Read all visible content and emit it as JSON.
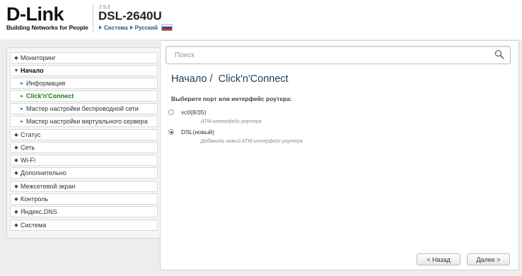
{
  "header": {
    "logo_text": "D-Link",
    "logo_tagline": "Building Networks for People",
    "firmware": "2.5.3",
    "model": "DSL-2640U",
    "crumbs": [
      "Система",
      "Русский"
    ]
  },
  "sidebar": {
    "items": [
      {
        "label": "Мониторинг",
        "icon": "plus-icon"
      },
      {
        "label": "Начало",
        "icon": "minus-icon"
      },
      {
        "label": "Информация",
        "icon": "arrow-right-icon"
      },
      {
        "label": "Click'n'Connect",
        "icon": "arrow-right-icon"
      },
      {
        "label": "Мастер настройки беспроводной сети",
        "icon": "arrow-right-icon"
      },
      {
        "label": "Мастер настройки виртуального сервера",
        "icon": "arrow-right-icon"
      },
      {
        "label": "Статус",
        "icon": "plus-icon"
      },
      {
        "label": "Сеть",
        "icon": "plus-icon"
      },
      {
        "label": "Wi-Fi",
        "icon": "plus-icon"
      },
      {
        "label": "Дополнительно",
        "icon": "plus-icon"
      },
      {
        "label": "Межсетевой экран",
        "icon": "plus-icon"
      },
      {
        "label": "Контроль",
        "icon": "plus-icon"
      },
      {
        "label": "Яндекс.DNS",
        "icon": "plus-icon"
      },
      {
        "label": "Система",
        "icon": "plus-icon"
      }
    ]
  },
  "main": {
    "search_placeholder": "Поиск",
    "title_section": "Начало /",
    "title_page": "Click'n'Connect",
    "prompt": "Выберите порт или интерфейс роутера:",
    "options": [
      {
        "label": "vc0(8/35)",
        "desc": "ATM-интерфейс роутера",
        "selected": false
      },
      {
        "label": "DSL(новый)",
        "desc": "Добавить новый ATM-интерфейс роутера",
        "selected": true
      }
    ],
    "back_label": "< Назад",
    "next_label": "Далее >"
  },
  "colors": {
    "title": "#1f3c5a",
    "current_item": "#1a7a1a",
    "crumbs": "#1f5c8a"
  }
}
